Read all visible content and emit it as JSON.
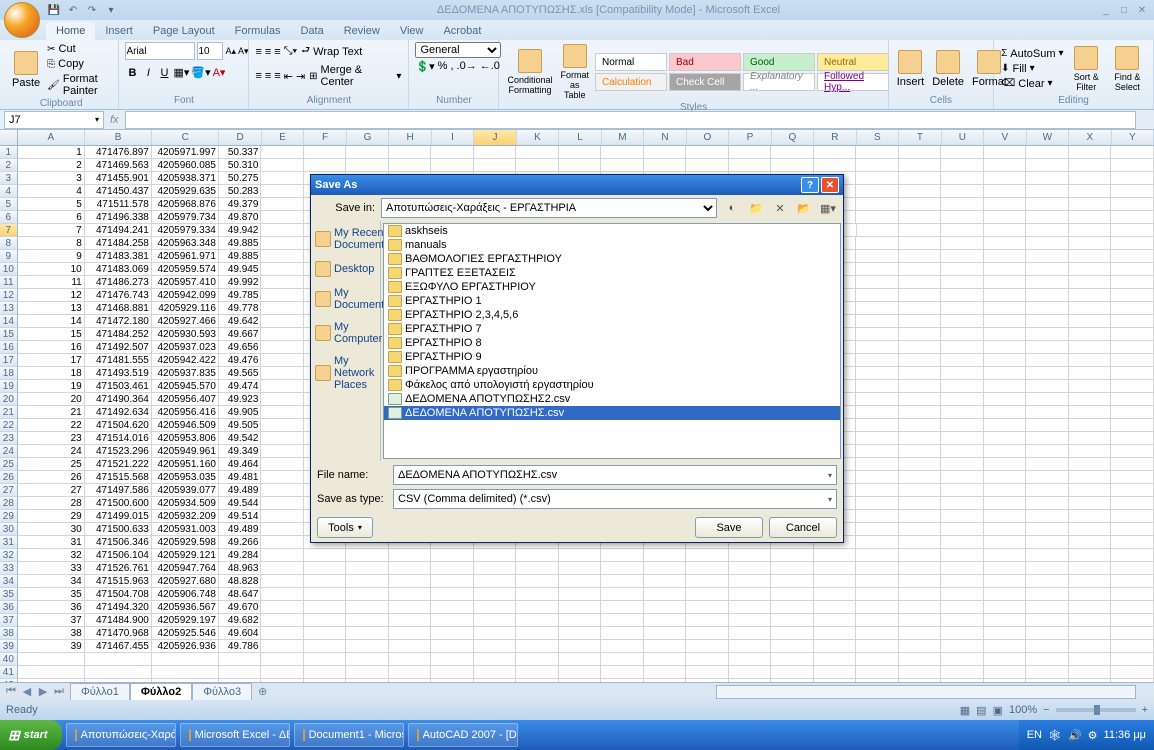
{
  "app": {
    "title": "ΔΕΔΟΜΕΝΑ ΑΠΟΤΥΠΩΣΗΣ.xls  [Compatibility Mode] - Microsoft Excel"
  },
  "tabs": [
    "Home",
    "Insert",
    "Page Layout",
    "Formulas",
    "Data",
    "Review",
    "View",
    "Acrobat"
  ],
  "active_tab": "Home",
  "clipboard": {
    "paste": "Paste",
    "cut": "Cut",
    "copy": "Copy",
    "format_painter": "Format Painter",
    "label": "Clipboard"
  },
  "font": {
    "name": "Arial",
    "size": "10",
    "label": "Font"
  },
  "alignment": {
    "wrap": "Wrap Text",
    "merge": "Merge & Center",
    "label": "Alignment"
  },
  "number": {
    "format": "General",
    "label": "Number"
  },
  "styles": {
    "cond": "Conditional Formatting",
    "table": "Format as Table",
    "items": [
      {
        "label": "Normal",
        "bg": "#fff",
        "color": "#000"
      },
      {
        "label": "Bad",
        "bg": "#ffc7ce",
        "color": "#9c0006"
      },
      {
        "label": "Good",
        "bg": "#c6efce",
        "color": "#006100"
      },
      {
        "label": "Neutral",
        "bg": "#ffeb9c",
        "color": "#9c6500"
      },
      {
        "label": "Calculation",
        "bg": "#f2f2f2",
        "color": "#fa7d00"
      },
      {
        "label": "Check Cell",
        "bg": "#a5a5a5",
        "color": "#fff"
      },
      {
        "label": "Explanatory ...",
        "bg": "#fff",
        "color": "#7f7f7f",
        "italic": true
      },
      {
        "label": "Followed Hyp...",
        "bg": "#fff",
        "color": "#800080",
        "underline": true
      }
    ],
    "label": "Styles"
  },
  "cells_group": {
    "insert": "Insert",
    "delete": "Delete",
    "format": "Format",
    "label": "Cells"
  },
  "editing": {
    "autosum": "AutoSum",
    "fill": "Fill",
    "clear": "Clear",
    "sort": "Sort & Filter",
    "find": "Find & Select",
    "label": "Editing"
  },
  "namebox": "J7",
  "columns": [
    "A",
    "B",
    "C",
    "D",
    "E",
    "F",
    "G",
    "H",
    "I",
    "J",
    "K",
    "L",
    "M",
    "N",
    "O",
    "P",
    "Q",
    "R",
    "S",
    "T",
    "U",
    "V",
    "W",
    "X",
    "Y"
  ],
  "selected_col": "J",
  "selected_row": 7,
  "data_rows": [
    [
      1,
      "471476.897",
      "4205971.997",
      "50.337"
    ],
    [
      2,
      "471469.563",
      "4205960.085",
      "50.310"
    ],
    [
      3,
      "471455.901",
      "4205938.371",
      "50.275"
    ],
    [
      4,
      "471450.437",
      "4205929.635",
      "50.283"
    ],
    [
      5,
      "471511.578",
      "4205968.876",
      "49.379"
    ],
    [
      6,
      "471496.338",
      "4205979.734",
      "49.870"
    ],
    [
      7,
      "471494.241",
      "4205979.334",
      "49.942"
    ],
    [
      8,
      "471484.258",
      "4205963.348",
      "49.885"
    ],
    [
      9,
      "471483.381",
      "4205961.971",
      "49.885"
    ],
    [
      10,
      "471483.069",
      "4205959.574",
      "49.945"
    ],
    [
      11,
      "471486.273",
      "4205957.410",
      "49.992"
    ],
    [
      12,
      "471476.743",
      "4205942.099",
      "49.785"
    ],
    [
      13,
      "471468.881",
      "4205929.116",
      "49.778"
    ],
    [
      14,
      "471472.180",
      "4205927.466",
      "49.642"
    ],
    [
      15,
      "471484.252",
      "4205930.593",
      "49.667"
    ],
    [
      16,
      "471492.507",
      "4205937.023",
      "49.656"
    ],
    [
      17,
      "471481.555",
      "4205942.422",
      "49.476"
    ],
    [
      18,
      "471493.519",
      "4205937.835",
      "49.565"
    ],
    [
      19,
      "471503.461",
      "4205945.570",
      "49.474"
    ],
    [
      20,
      "471490.364",
      "4205956.407",
      "49.923"
    ],
    [
      21,
      "471492.634",
      "4205956.416",
      "49.905"
    ],
    [
      22,
      "471504.620",
      "4205946.509",
      "49.505"
    ],
    [
      23,
      "471514.016",
      "4205953.806",
      "49.542"
    ],
    [
      24,
      "471523.296",
      "4205949.961",
      "49.349"
    ],
    [
      25,
      "471521.222",
      "4205951.160",
      "49.464"
    ],
    [
      26,
      "471515.568",
      "4205953.035",
      "49.481"
    ],
    [
      27,
      "471497.586",
      "4205939.077",
      "49.489"
    ],
    [
      28,
      "471500.600",
      "4205934.509",
      "49.544"
    ],
    [
      29,
      "471499.015",
      "4205932.209",
      "49.514"
    ],
    [
      30,
      "471500.633",
      "4205931.003",
      "49.489"
    ],
    [
      31,
      "471506.346",
      "4205929.598",
      "49.266"
    ],
    [
      32,
      "471506.104",
      "4205929.121",
      "49.284"
    ],
    [
      33,
      "471526.761",
      "4205947.764",
      "48.963"
    ],
    [
      34,
      "471515.963",
      "4205927.680",
      "48.828"
    ],
    [
      35,
      "471504.708",
      "4205906.748",
      "48.647"
    ],
    [
      36,
      "471494.320",
      "4205936.567",
      "49.670"
    ],
    [
      37,
      "471484.900",
      "4205929.197",
      "49.682"
    ],
    [
      38,
      "471470.968",
      "4205925.546",
      "49.604"
    ],
    [
      39,
      "471467.455",
      "4205926.936",
      "49.786"
    ]
  ],
  "sheet_tabs": [
    "Φύλλο1",
    "Φύλλο2",
    "Φύλλο3"
  ],
  "active_sheet": "Φύλλο2",
  "status": "Ready",
  "zoom": "100%",
  "taskbar": {
    "start": "start",
    "items": [
      "Αποτυπώσεις-Χαράξ...",
      "Microsoft Excel - ΔΕ...",
      "Document1 - Microsof...",
      "AutoCAD 2007 - [Dra..."
    ],
    "lang": "EN",
    "time": "11:36 μμ"
  },
  "dialog": {
    "title": "Save As",
    "save_in_label": "Save in:",
    "save_in": "Αποτυπώσεις-Χαράξεις - ΕΡΓΑΣΤΗΡΙΑ",
    "places": [
      "My Recent Documents",
      "Desktop",
      "My Documents",
      "My Computer",
      "My Network Places"
    ],
    "files": [
      {
        "name": "askhseis",
        "type": "folder"
      },
      {
        "name": "manuals",
        "type": "folder"
      },
      {
        "name": "ΒΑΘΜΟΛΟΓΙΕΣ ΕΡΓΑΣΤΗΡΙΟΥ",
        "type": "folder"
      },
      {
        "name": "ΓΡΑΠΤΕΣ ΕΞΕΤΑΣΕΙΣ",
        "type": "folder"
      },
      {
        "name": "ΕΞΩΦΥΛΟ ΕΡΓΑΣΤΗΡΙΟΥ",
        "type": "folder"
      },
      {
        "name": "ΕΡΓΑΣΤΗΡΙΟ 1",
        "type": "folder"
      },
      {
        "name": "ΕΡΓΑΣΤΗΡΙΟ 2,3,4,5,6",
        "type": "folder"
      },
      {
        "name": "ΕΡΓΑΣΤΗΡΙΟ 7",
        "type": "folder"
      },
      {
        "name": "ΕΡΓΑΣΤΗΡΙΟ 8",
        "type": "folder"
      },
      {
        "name": "ΕΡΓΑΣΤΗΡΙΟ 9",
        "type": "folder"
      },
      {
        "name": "ΠΡΟΓΡΑΜΜΑ εργαστηρίου",
        "type": "folder"
      },
      {
        "name": "Φάκελος από υπολογιστή εργαστηρίου",
        "type": "folder"
      },
      {
        "name": "ΔΕΔΟΜΕΝΑ ΑΠΟΤΥΠΩΣΗΣ2.csv",
        "type": "file"
      },
      {
        "name": "ΔΕΔΟΜΕΝΑ ΑΠΟΤΥΠΩΣΗΣ.csv",
        "type": "file",
        "selected": true
      }
    ],
    "filename_label": "File name:",
    "filename": "ΔΕΔΟΜΕΝΑ ΑΠΟΤΥΠΩΣΗΣ.csv",
    "savetype_label": "Save as type:",
    "savetype": "CSV (Comma delimited) (*.csv)",
    "tools": "Tools",
    "save": "Save",
    "cancel": "Cancel"
  }
}
